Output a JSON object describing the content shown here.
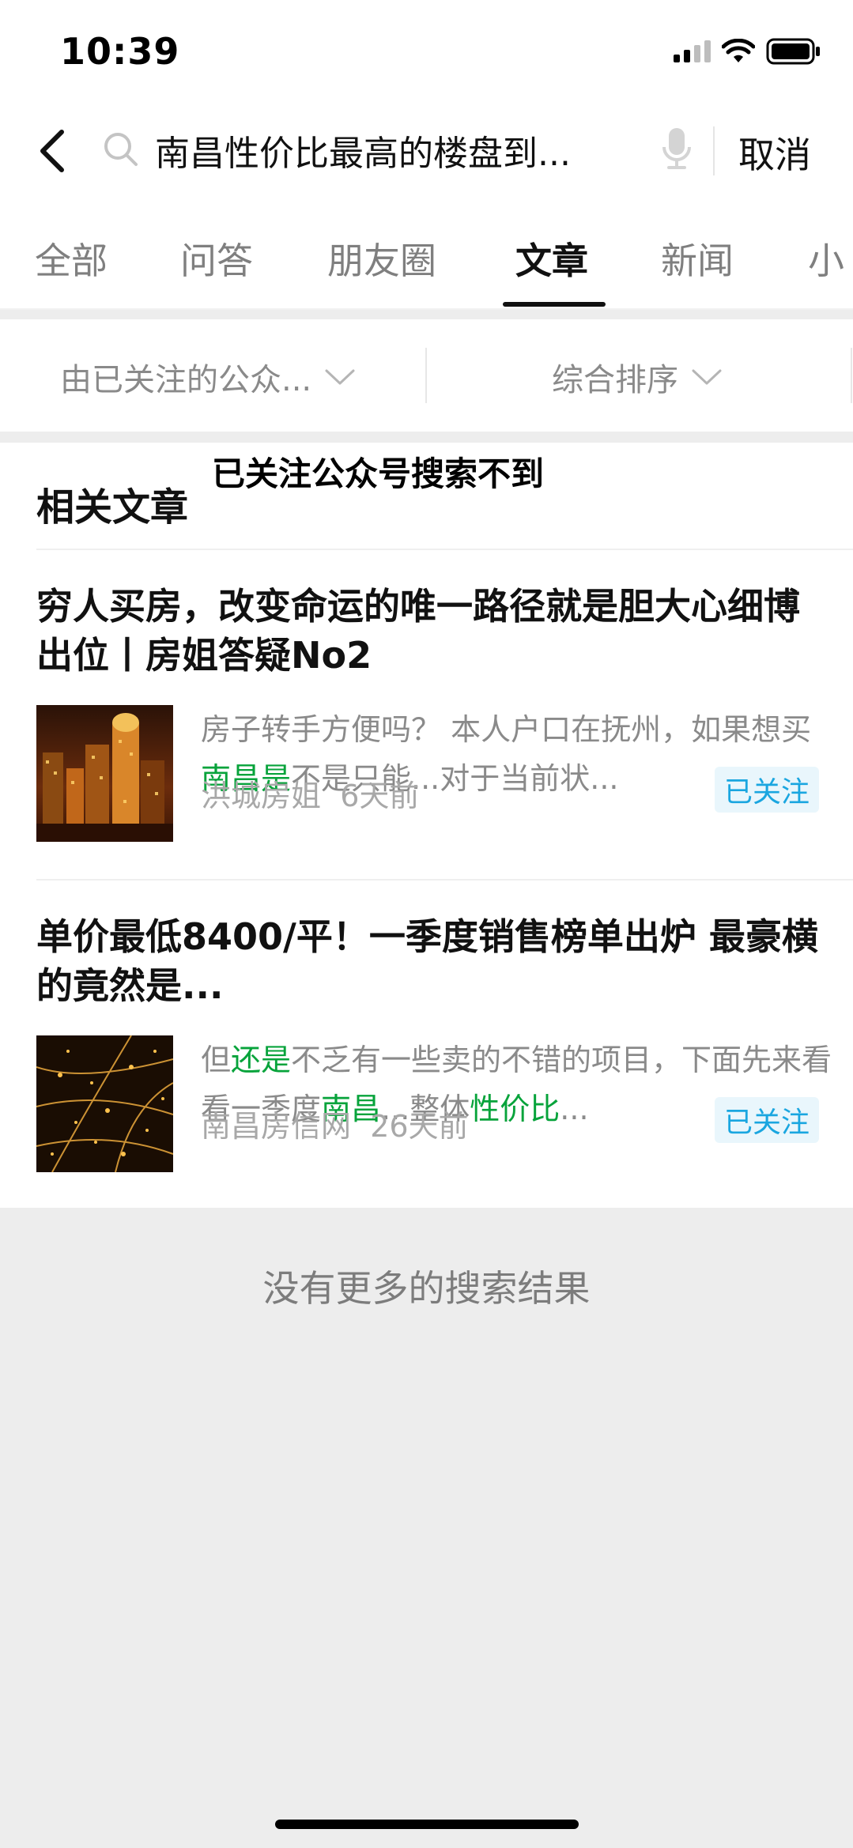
{
  "status_bar": {
    "time": "10:39"
  },
  "search": {
    "query": "南昌性价比最高的楼盘到...",
    "cancel_label": "取消"
  },
  "tabs": [
    {
      "label": "全部"
    },
    {
      "label": "问答"
    },
    {
      "label": "朋友圈"
    },
    {
      "label": "文章"
    },
    {
      "label": "新闻"
    },
    {
      "label": "小"
    }
  ],
  "filters": {
    "source": "由已关注的公众...",
    "sort": "综合排序"
  },
  "results": {
    "section_title": "相关文章",
    "tooltip": "已关注公众号搜索不到",
    "articles": [
      {
        "title": "穷人买房，改变命运的唯一路径就是胆大心细博出位丨房姐答疑No2",
        "snippet": [
          {
            "text": "房子转手方便吗？ 本人户口在抚州，如果想买",
            "hl": false
          },
          {
            "text": "南昌是",
            "hl": true
          },
          {
            "text": "不是只能...对于当前状...",
            "hl": false
          }
        ],
        "source": "洪城房姐",
        "time": "6天前",
        "badge": "已关注"
      },
      {
        "title": "单价最低8400/平！一季度销售榜单出炉 最豪横的竟然是...",
        "snippet": [
          {
            "text": "但",
            "hl": false
          },
          {
            "text": "还是",
            "hl": true
          },
          {
            "text": "不乏有一些卖的不错的项目，下面先来看看一季度",
            "hl": false
          },
          {
            "text": "南昌",
            "hl": true
          },
          {
            "text": "...整体",
            "hl": false
          },
          {
            "text": "性价比",
            "hl": true
          },
          {
            "text": "...",
            "hl": false
          }
        ],
        "source": "南昌房信网",
        "time": "26天前",
        "badge": "已关注"
      }
    ]
  },
  "footer": {
    "no_more": "没有更多的搜索结果"
  },
  "colors": {
    "highlight": "#07a33b",
    "badge_text": "#1aa6e0",
    "badge_bg": "#e9f6fc",
    "background": "#ededed"
  }
}
